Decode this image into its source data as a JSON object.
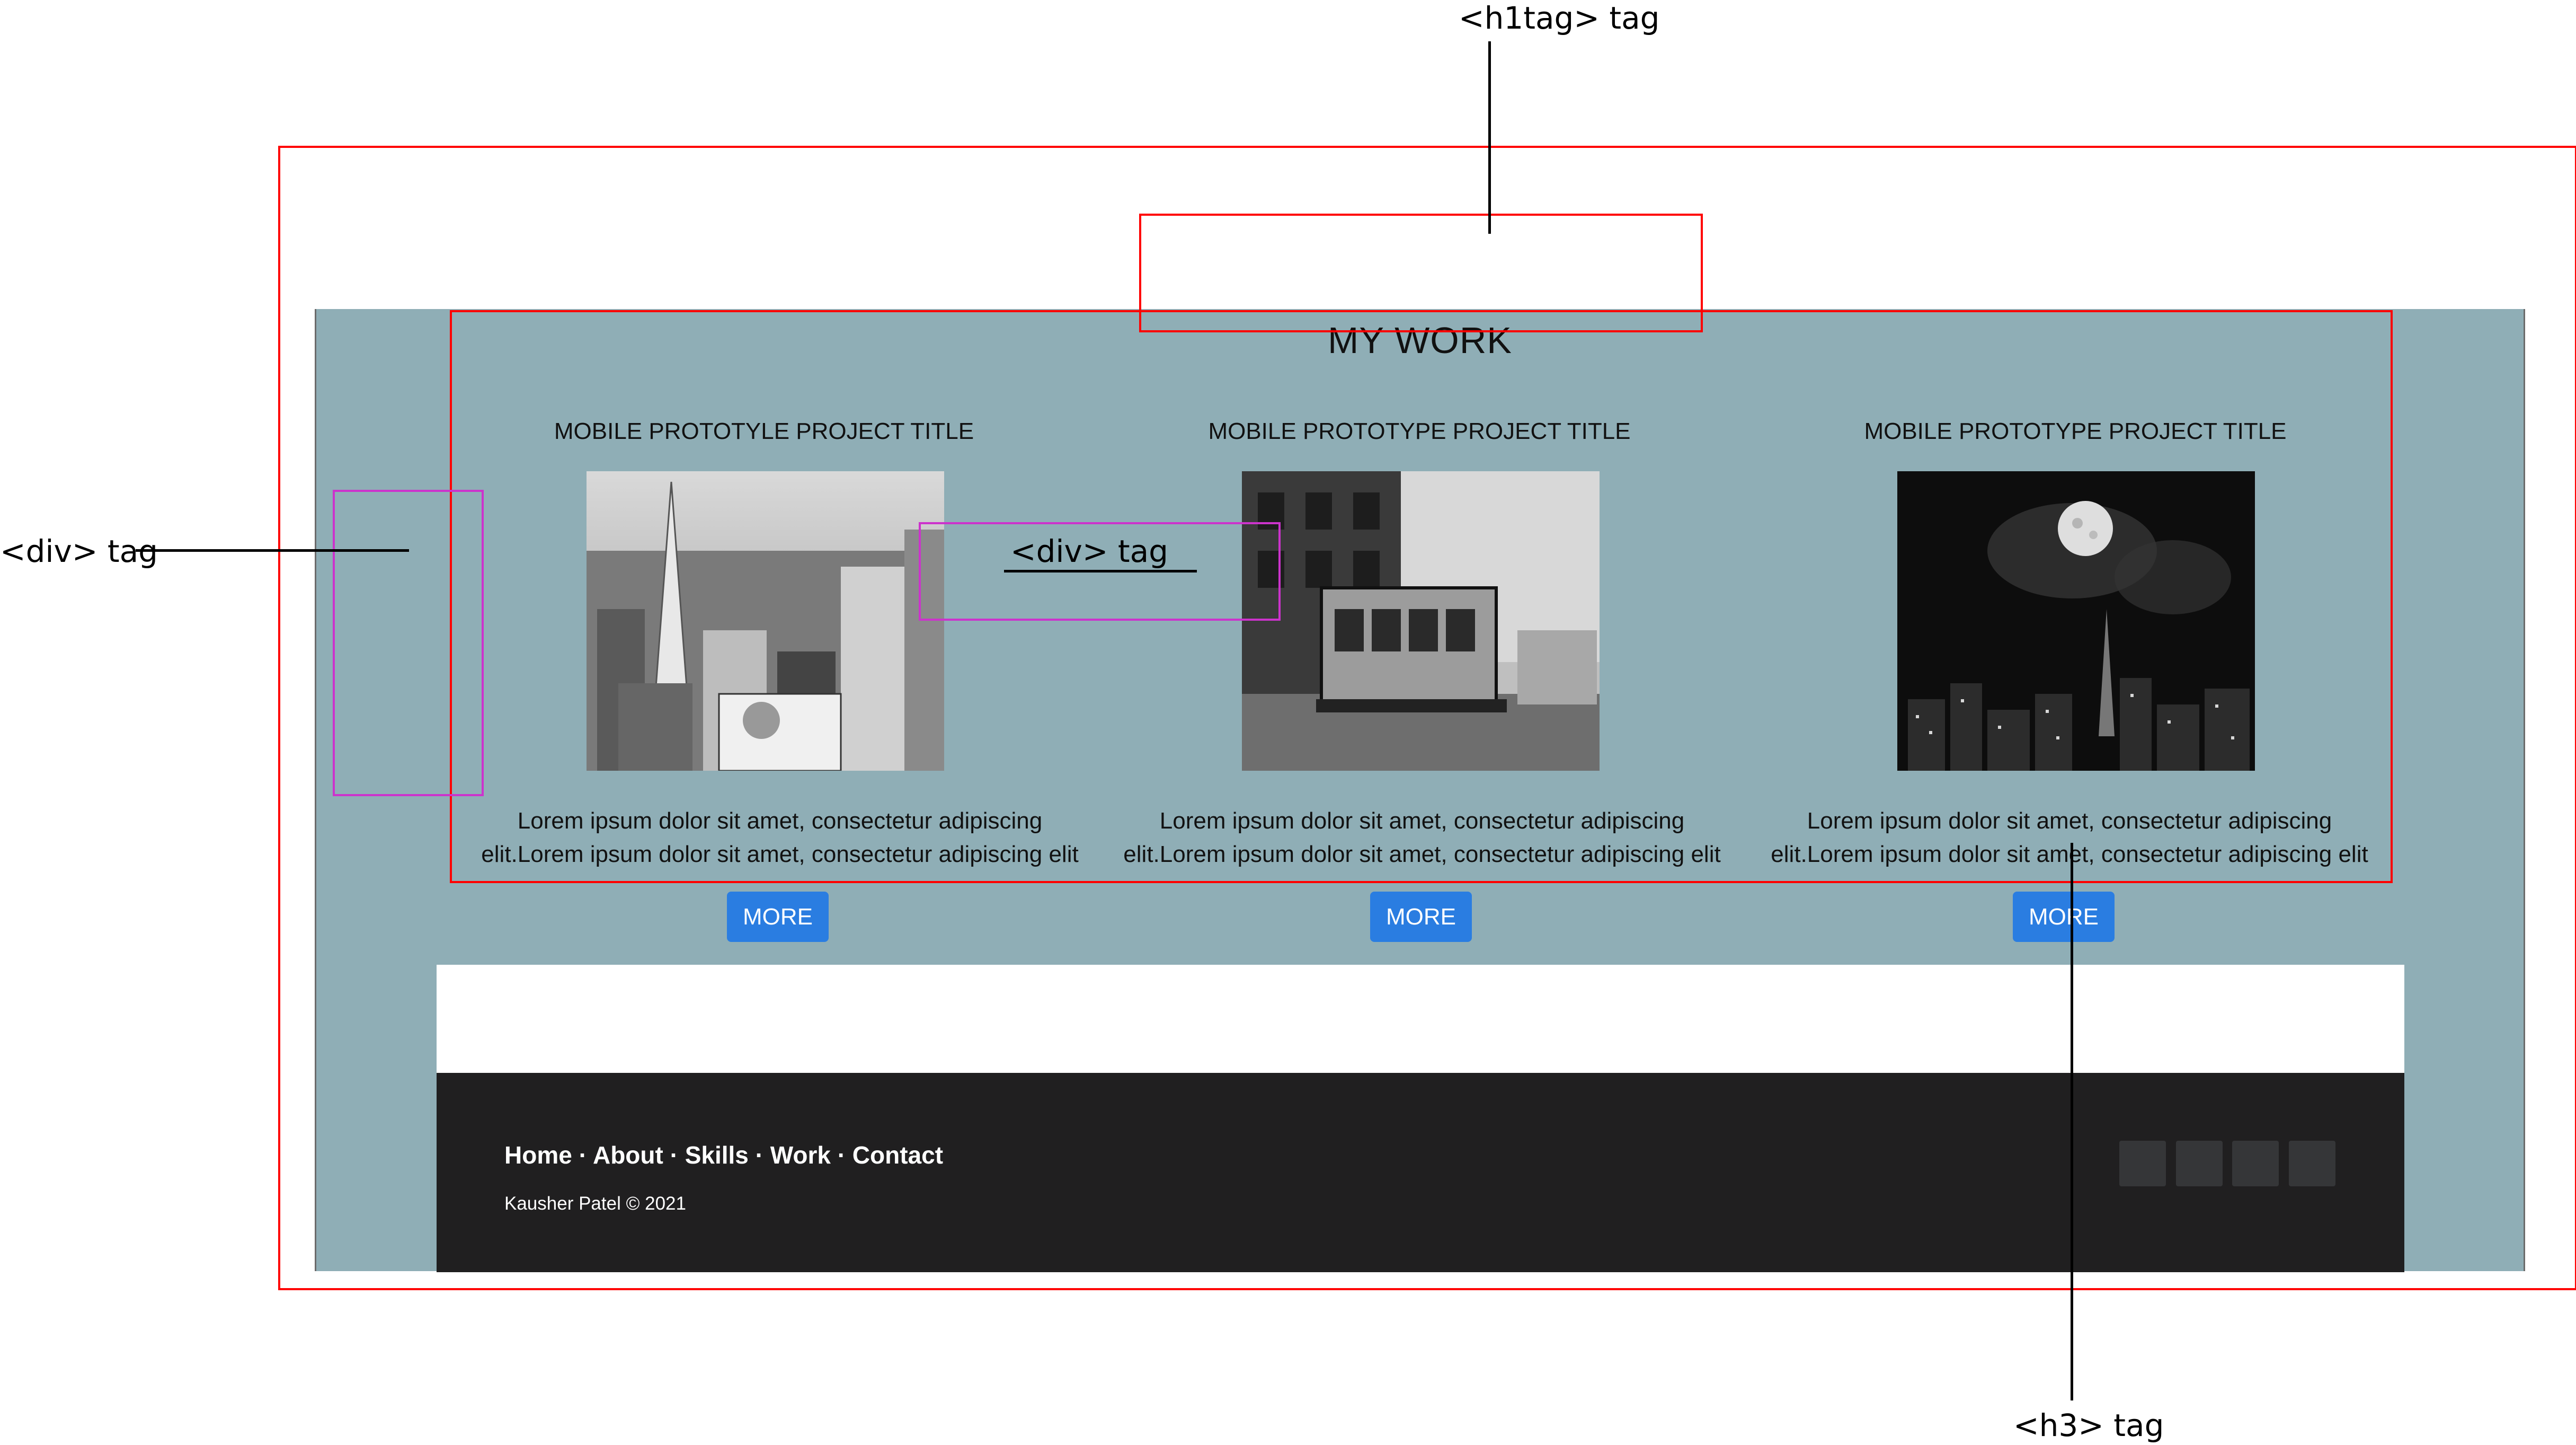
{
  "annotations": {
    "h1_tag": "<h1tag> tag",
    "div_tag_left": "<div> tag",
    "div_tag_inner": "<div> tag",
    "h3_tag": "<h3> tag"
  },
  "page": {
    "title": "MY WORK",
    "projects": [
      {
        "title": "MOBILE PROTOTYLE PROJECT TITLE",
        "desc_line1": "Lorem ipsum dolor sit amet, consectetur adipiscing",
        "desc_line2": "elit.Lorem ipsum dolor sit amet, consectetur adipiscing elit",
        "button": "MORE"
      },
      {
        "title": "MOBILE PROTOTYPE PROJECT TITLE",
        "desc_line1": "Lorem ipsum dolor sit amet, consectetur adipiscing",
        "desc_line2": "elit.Lorem ipsum dolor sit amet, consectetur adipiscing elit",
        "button": "MORE"
      },
      {
        "title": "MOBILE PROTOTYPE PROJECT TITLE",
        "desc_line1": "Lorem ipsum dolor sit amet, consectetur adipiscing",
        "desc_line2": "elit.Lorem ipsum dolor sit amet, consectetur adipiscing elit",
        "button": "MORE"
      }
    ]
  },
  "footer": {
    "nav": "Home · About · Skills · Work · Contact",
    "copyright": "Kausher Patel © 2021"
  },
  "colors": {
    "panel": "#8faeb6",
    "footer": "#201f20",
    "button": "#2a7de1",
    "annotation_red": "#ff0000",
    "annotation_magenta": "#cc33cc"
  }
}
